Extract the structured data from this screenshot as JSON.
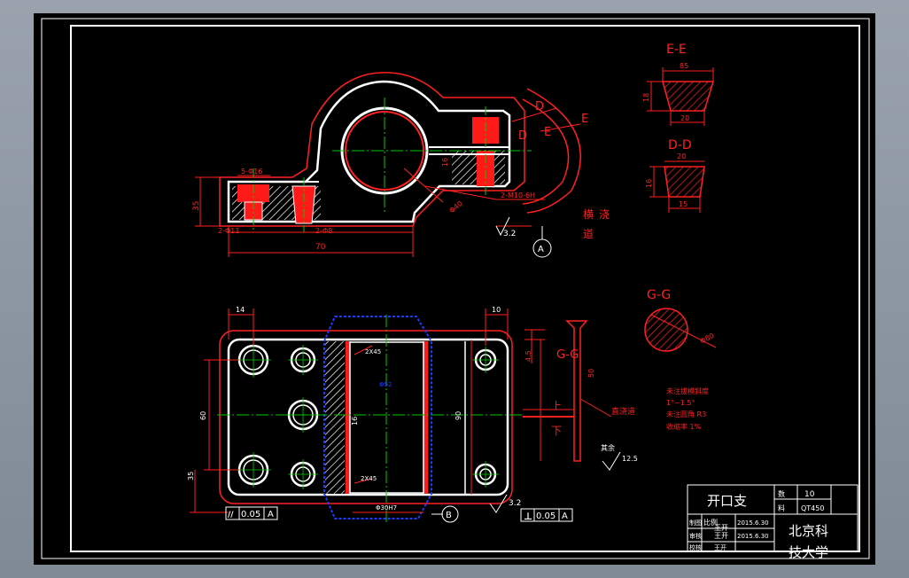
{
  "top_view": {
    "dims": {
      "bolt_hole": "5-Φ16",
      "height_35": "35",
      "thread_hole": "2-M10-6H",
      "bottom_hole": "2-Φ8",
      "left_hole": "2-Φ11",
      "length_70": "70",
      "radius": "Φ40",
      "height_16": "16",
      "depth": "18",
      "roughness": "3.2",
      "datum": "A"
    },
    "section_marks": {
      "d_upper": "D",
      "d_lower": "D",
      "e_upper": "E",
      "e_lower": "E"
    },
    "notes": {
      "pour_char1": "横",
      "pour_char2": "浇",
      "pour_char3": "道"
    }
  },
  "section_ee": {
    "title": "E-E",
    "top": "85",
    "height": "18",
    "bottom": "20"
  },
  "section_dd": {
    "title": "D-D",
    "top": "20",
    "height": "16",
    "bottom": "15"
  },
  "section_gg": {
    "title": "G-G",
    "dia": "Φ80"
  },
  "front_view": {
    "dims": {
      "left_14": "14",
      "right_10": "10",
      "width_60": "60",
      "width_90": "90",
      "offset_35": "35",
      "chamfer_top": "2X45",
      "chamfer_bottom": "2X45",
      "bore": "Φ30H7",
      "len_16": "16",
      "gap_45": "4.5",
      "len_50": "50",
      "inner": "Φ52",
      "roughness": "3.2",
      "gg_mark": "G-G",
      "up_mark": "上",
      "down_mark": "下",
      "riser": "直浇道",
      "datum": "B"
    },
    "tolerance_left": {
      "symbol": "//",
      "value": "0.05",
      "datum": "A"
    },
    "tolerance_right": {
      "symbol": "⊥",
      "value": "0.05",
      "datum": "A"
    }
  },
  "tech_notes": {
    "line1": "未注拔模斜度",
    "line2": "1°~1.5°",
    "line3": "未注圆角 R3",
    "line4": "收缩率 1%"
  },
  "surface_note": {
    "label": "其余",
    "value": "12.5"
  },
  "title_block": {
    "part_name": "开口支",
    "count_label": "数",
    "count_value": "10",
    "material_label": "料",
    "material_value": "QT450",
    "scale_label": "比例",
    "row1_label": "制图",
    "row1_name": "王开",
    "row1_date": "2015.6.30",
    "row2_label": "审核",
    "row2_name": "王开",
    "row2_date": "2015.6.30",
    "row3_label": "校核",
    "row3_name": "王开",
    "school_line1": "北京科",
    "school_line2": "技大学"
  },
  "colors": {
    "background": "#000000",
    "outline": "#ffffff",
    "dimension": "#ff2020",
    "center_line": "#00c800",
    "fill_red": "#ff1a1a",
    "bore_blue": "#1a3cff"
  }
}
